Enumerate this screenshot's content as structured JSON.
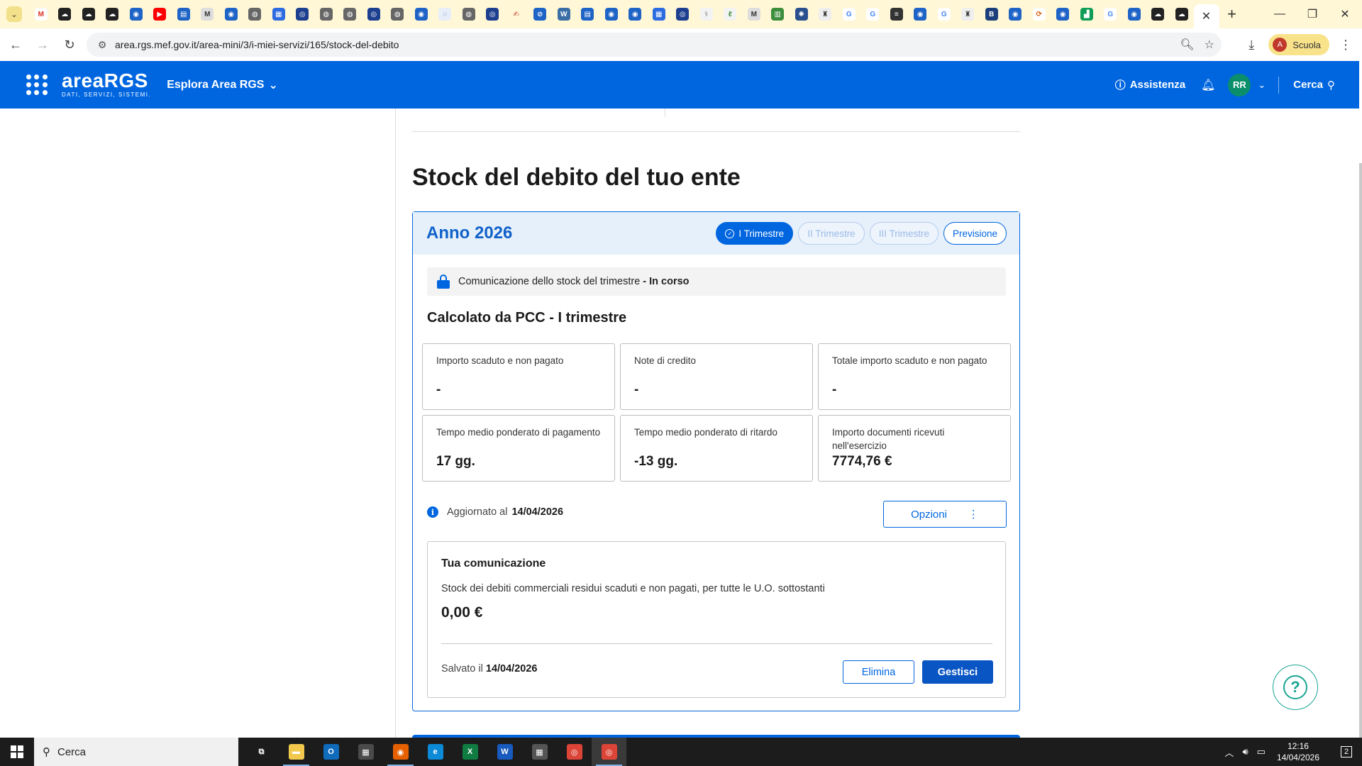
{
  "browser": {
    "url": "area.rgs.mef.gov.it/area-mini/3/i-miei-servizi/165/stock-del-debito",
    "profile_label": "Scuola",
    "profile_initial": "A",
    "favicons": [
      {
        "name": "gmail-icon",
        "color": "#ffffff",
        "glyph": "M",
        "fg": "#d93025"
      },
      {
        "name": "cloud-icon",
        "color": "#222222",
        "glyph": "☁",
        "fg": "#ffffff"
      },
      {
        "name": "cloud-icon",
        "color": "#222222",
        "glyph": "☁",
        "fg": "#ffffff"
      },
      {
        "name": "cloud-icon",
        "color": "#222222",
        "glyph": "☁",
        "fg": "#ffffff"
      },
      {
        "name": "site-icon",
        "color": "#1e63c6",
        "glyph": "◉",
        "fg": "#ffffff"
      },
      {
        "name": "youtube-icon",
        "color": "#ff0000",
        "glyph": "▶",
        "fg": "#ffffff"
      },
      {
        "name": "site-icon",
        "color": "#1e63c6",
        "glyph": "▤",
        "fg": "#ffffff"
      },
      {
        "name": "mef-icon",
        "color": "#dddddd",
        "glyph": "M",
        "fg": "#333333"
      },
      {
        "name": "site-icon",
        "color": "#1e63c6",
        "glyph": "◉",
        "fg": "#ffffff"
      },
      {
        "name": "globe-icon",
        "color": "#666666",
        "glyph": "◍",
        "fg": "#ffffff"
      },
      {
        "name": "site-icon",
        "color": "#2d6be0",
        "glyph": "▦",
        "fg": "#ffffff"
      },
      {
        "name": "site-icon",
        "color": "#1d3f8f",
        "glyph": "◎",
        "fg": "#ffffff"
      },
      {
        "name": "globe-icon",
        "color": "#666666",
        "glyph": "◍",
        "fg": "#ffffff"
      },
      {
        "name": "globe-icon",
        "color": "#666666",
        "glyph": "◍",
        "fg": "#ffffff"
      },
      {
        "name": "site-icon",
        "color": "#1d3f8f",
        "glyph": "◎",
        "fg": "#ffffff"
      },
      {
        "name": "globe-icon",
        "color": "#666666",
        "glyph": "◍",
        "fg": "#ffffff"
      },
      {
        "name": "site-icon",
        "color": "#1e63c6",
        "glyph": "◉",
        "fg": "#ffffff"
      },
      {
        "name": "site-icon",
        "color": "#e8eef8",
        "glyph": "◌",
        "fg": "#1e63c6"
      },
      {
        "name": "globe-icon",
        "color": "#666666",
        "glyph": "◍",
        "fg": "#ffffff"
      },
      {
        "name": "site-icon",
        "color": "#1d3f8f",
        "glyph": "◎",
        "fg": "#ffffff"
      },
      {
        "name": "sign-icon",
        "color": "#fff7d6",
        "glyph": "✍",
        "fg": "#c0392b"
      },
      {
        "name": "site-icon",
        "color": "#1e63c6",
        "glyph": "⊘",
        "fg": "#ffffff"
      },
      {
        "name": "wordpress-icon",
        "color": "#3a6ea5",
        "glyph": "W",
        "fg": "#ffffff"
      },
      {
        "name": "site-icon",
        "color": "#1e63c6",
        "glyph": "▤",
        "fg": "#ffffff"
      },
      {
        "name": "site-icon",
        "color": "#1e63c6",
        "glyph": "◉",
        "fg": "#ffffff"
      },
      {
        "name": "site-icon",
        "color": "#1e63c6",
        "glyph": "◉",
        "fg": "#ffffff"
      },
      {
        "name": "site-icon",
        "color": "#2d6be0",
        "glyph": "▦",
        "fg": "#ffffff"
      },
      {
        "name": "site-icon",
        "color": "#1d3f8f",
        "glyph": "◎",
        "fg": "#ffffff"
      },
      {
        "name": "site-icon",
        "color": "#f3f3f3",
        "glyph": "⚕",
        "fg": "#777777"
      },
      {
        "name": "site-icon",
        "color": "#f3f3f3",
        "glyph": "ℓ",
        "fg": "#3c8d3c"
      },
      {
        "name": "mef-icon",
        "color": "#dddddd",
        "glyph": "M",
        "fg": "#333333"
      },
      {
        "name": "site-icon",
        "color": "#3c8d3c",
        "glyph": "▥",
        "fg": "#ffffff"
      },
      {
        "name": "site-icon",
        "color": "#2a4f8f",
        "glyph": "✺",
        "fg": "#ffffff"
      },
      {
        "name": "site-icon",
        "color": "#eeeeee",
        "glyph": "♜",
        "fg": "#333333"
      },
      {
        "name": "google-icon",
        "color": "#ffffff",
        "glyph": "G",
        "fg": "#4285f4"
      },
      {
        "name": "google-icon",
        "color": "#ffffff",
        "glyph": "G",
        "fg": "#4285f4"
      },
      {
        "name": "site-icon",
        "color": "#333333",
        "glyph": "≡",
        "fg": "#ffffff"
      },
      {
        "name": "site-icon",
        "color": "#1e63c6",
        "glyph": "◉",
        "fg": "#ffffff"
      },
      {
        "name": "google-icon",
        "color": "#ffffff",
        "glyph": "G",
        "fg": "#4285f4"
      },
      {
        "name": "site-icon",
        "color": "#eeeeee",
        "glyph": "♜",
        "fg": "#333333"
      },
      {
        "name": "site-icon",
        "color": "#1a3f7a",
        "glyph": "B",
        "fg": "#ffffff"
      },
      {
        "name": "site-icon",
        "color": "#1e63c6",
        "glyph": "◉",
        "fg": "#ffffff"
      },
      {
        "name": "site-icon",
        "color": "#ffffff",
        "glyph": "⟳",
        "fg": "#d35400"
      },
      {
        "name": "site-icon",
        "color": "#1e63c6",
        "glyph": "◉",
        "fg": "#ffffff"
      },
      {
        "name": "sheets-icon",
        "color": "#0f9d58",
        "glyph": "▟",
        "fg": "#ffffff"
      },
      {
        "name": "google-icon",
        "color": "#ffffff",
        "glyph": "G",
        "fg": "#4285f4"
      },
      {
        "name": "site-icon",
        "color": "#1e63c6",
        "glyph": "◉",
        "fg": "#ffffff"
      },
      {
        "name": "cloud-icon",
        "color": "#222222",
        "glyph": "☁",
        "fg": "#ffffff"
      },
      {
        "name": "cloud-icon",
        "color": "#222222",
        "glyph": "☁",
        "fg": "#ffffff"
      }
    ]
  },
  "header": {
    "logo_text": "areaRGS",
    "logo_sub": "DATI, SERVIZI, SISTEMI.",
    "explore_label": "Esplora Area RGS",
    "help_label": "Assistenza",
    "user_initials": "RR",
    "search_label": "Cerca"
  },
  "page": {
    "title": "Stock del debito del tuo ente",
    "year_label": "Anno 2026",
    "quarters": [
      {
        "label": "I Trimestre",
        "state": "active"
      },
      {
        "label": "II Trimestre",
        "state": "disabled"
      },
      {
        "label": "III Trimestre",
        "state": "disabled"
      },
      {
        "label": "Previsione",
        "state": "enabled"
      }
    ],
    "status_text": "Comunicazione dello stock del trimestre",
    "status_value": "- In corso",
    "calc_title": "Calcolato da PCC - I trimestre",
    "stats": [
      {
        "label": "Importo scaduto e non pagato",
        "value": "-"
      },
      {
        "label": "Note di credito",
        "value": "-"
      },
      {
        "label": "Totale importo scaduto e non pagato",
        "value": "-"
      },
      {
        "label": "Tempo medio ponderato di pagamento",
        "value": "17 gg."
      },
      {
        "label": "Tempo medio ponderato di ritardo",
        "value": "-13 gg."
      },
      {
        "label": "Importo documenti ricevuti nell'esercizio",
        "value": "7774,76 €"
      }
    ],
    "updated_label": "Aggiornato al",
    "updated_date": "14/04/2026",
    "options_label": "Opzioni",
    "communication": {
      "title": "Tua comunicazione",
      "description": "Stock dei debiti commerciali residui scaduti e non pagati, per tutte le U.O. sottostanti",
      "value": "0,00 €",
      "saved_label": "Salvato il",
      "saved_date": "14/04/2026",
      "delete_label": "Elimina",
      "manage_label": "Gestisci"
    }
  },
  "taskbar": {
    "search_placeholder": "Cerca",
    "time": "12:16",
    "date": "14/04/2026",
    "notification_count": "2",
    "apps": [
      {
        "name": "task-view-icon",
        "color": "transparent",
        "glyph": "⧉",
        "on": false
      },
      {
        "name": "file-explorer-icon",
        "color": "#f2c94c",
        "glyph": "▬",
        "on": true
      },
      {
        "name": "outlook-icon",
        "color": "#0f6cbd",
        "glyph": "O",
        "on": false
      },
      {
        "name": "store-icon",
        "color": "#4a4a4a",
        "glyph": "▦",
        "on": false
      },
      {
        "name": "firefox-icon",
        "color": "#e66000",
        "glyph": "◉",
        "on": true
      },
      {
        "name": "edge-icon",
        "color": "#0c8ad6",
        "glyph": "e",
        "on": false
      },
      {
        "name": "excel-icon",
        "color": "#107c41",
        "glyph": "X",
        "on": false
      },
      {
        "name": "word-icon",
        "color": "#185abd",
        "glyph": "W",
        "on": false
      },
      {
        "name": "calculator-icon",
        "color": "#555555",
        "glyph": "▦",
        "on": false
      },
      {
        "name": "chrome-icon",
        "color": "#db4437",
        "glyph": "◎",
        "on": false
      },
      {
        "name": "chrome-profile-icon",
        "color": "#db4437",
        "glyph": "◎",
        "on": true
      }
    ]
  }
}
